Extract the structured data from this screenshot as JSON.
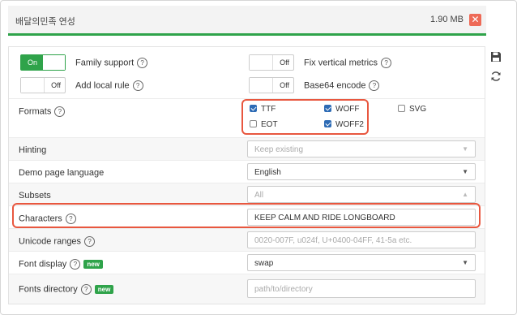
{
  "header": {
    "title": "배달의민족 연성",
    "size": "1.90 MB",
    "close_glyph": "✕"
  },
  "side_icons": [
    "save-icon",
    "refresh-icon"
  ],
  "toggles": {
    "family_support": {
      "state": "On",
      "label": "Family support"
    },
    "fix_vertical_metrics": {
      "state": "Off",
      "label": "Fix vertical metrics"
    },
    "add_local_rule": {
      "state": "Off",
      "label": "Add local rule"
    },
    "base64_encode": {
      "state": "Off",
      "label": "Base64 encode"
    }
  },
  "help_glyph": "?",
  "formats": {
    "label": "Formats",
    "options": [
      {
        "name": "TTF",
        "checked": true
      },
      {
        "name": "WOFF",
        "checked": true
      },
      {
        "name": "SVG",
        "checked": false
      },
      {
        "name": "EOT",
        "checked": false
      },
      {
        "name": "WOFF2",
        "checked": true
      }
    ]
  },
  "fields": {
    "hinting": {
      "label": "Hinting",
      "value": "Keep existing"
    },
    "demo_page_language": {
      "label": "Demo page language",
      "value": "English"
    },
    "subsets": {
      "label": "Subsets",
      "value": "All"
    },
    "characters": {
      "label": "Characters",
      "value": "KEEP CALM AND RIDE LONGBOARD"
    },
    "unicode_ranges": {
      "label": "Unicode ranges",
      "placeholder": "0020-007F, u024f, U+0400-04FF, 41-5a etc."
    },
    "font_display": {
      "label": "Font display",
      "badge": "new",
      "value": "swap"
    },
    "fonts_directory": {
      "label": "Fonts directory",
      "badge": "new",
      "placeholder": "path/to/directory"
    }
  },
  "caret_down": "▼",
  "caret_up": "▲",
  "colors": {
    "accent": "#2fa34a",
    "highlight": "#e8573f",
    "checkbox": "#2d6bb5"
  }
}
